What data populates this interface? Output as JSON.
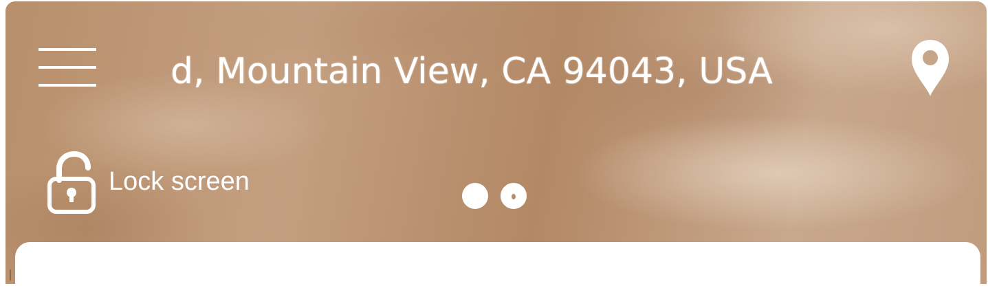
{
  "header": {
    "address": "d, Mountain View, CA 94043, USA",
    "menu_icon": "hamburger-menu-icon",
    "location_icon": "location-pin-icon"
  },
  "lock": {
    "label": "Lock screen",
    "icon": "unlocked-padlock-icon"
  },
  "pager": {
    "page_count": 2,
    "active_index": 0
  },
  "colors": {
    "text": "#ffffff",
    "background_tone": "#b88f6c",
    "sheet": "#ffffff"
  }
}
